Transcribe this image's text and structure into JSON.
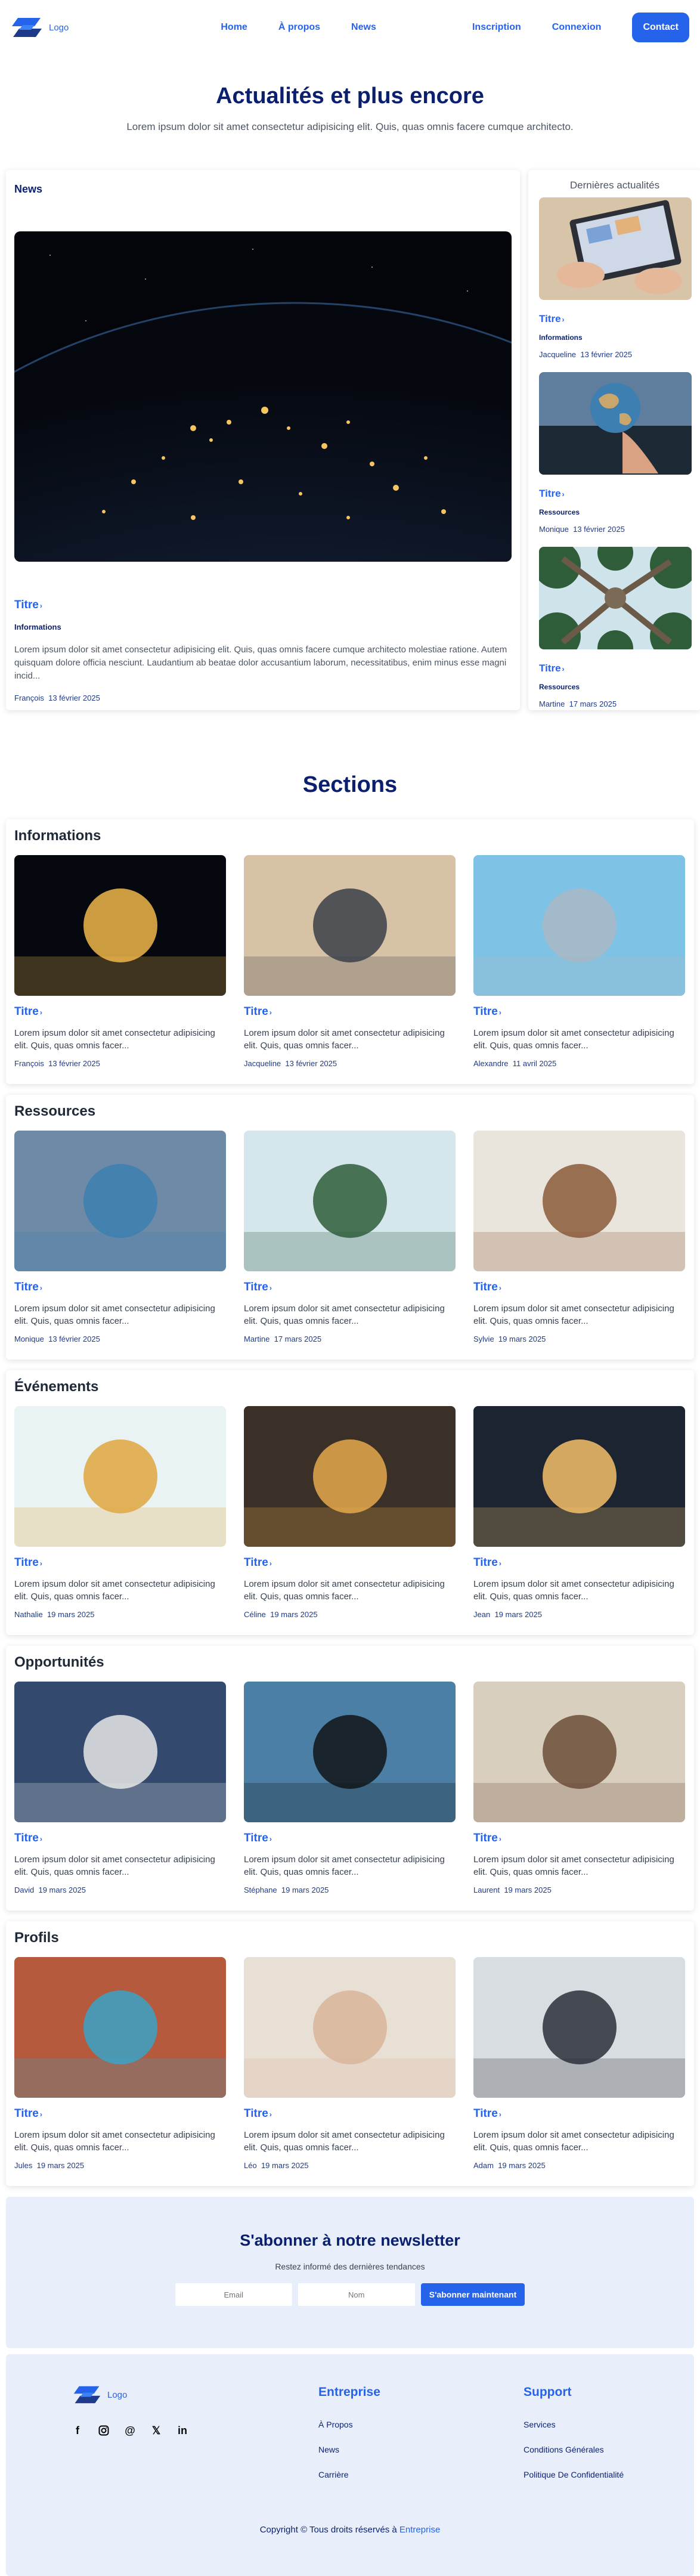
{
  "header": {
    "logo_text": "Logo",
    "nav": [
      "Home",
      "À propos",
      "News"
    ],
    "signup": "Inscription",
    "login": "Connexion",
    "contact": "Contact"
  },
  "hero": {
    "title": "Actualités et plus encore",
    "subtitle": "Lorem ipsum dolor sit amet consectetur adipisicing elit. Quis, quas omnis facere cumque architecto."
  },
  "news": {
    "label": "News",
    "title": "Titre",
    "category": "Informations",
    "description": "Lorem ipsum dolor sit amet consectetur adipisicing elit. Quis, quas omnis facere cumque architecto molestiae ratione. Autem quisquam dolore officia nesciunt. Laudantium ab beatae dolor accusantium laborum, necessitatibus, enim minus esse magni incid...",
    "author": "François",
    "date": "13 février 2025"
  },
  "latest": {
    "title": "Dernières actualités",
    "items": [
      {
        "title": "Titre",
        "category": "Informations",
        "author": "Jacqueline",
        "date": "13 février 2025"
      },
      {
        "title": "Titre",
        "category": "Ressources",
        "author": "Monique",
        "date": "13 février 2025"
      },
      {
        "title": "Titre",
        "category": "Ressources",
        "author": "Martine",
        "date": "17 mars 2025"
      }
    ]
  },
  "sections_title": "Sections",
  "card_desc": "Lorem ipsum dolor sit amet consectetur adipisicing elit. Quis, quas omnis facer...",
  "sections": [
    {
      "name": "Informations",
      "cards": [
        {
          "title": "Titre",
          "author": "François",
          "date": "13 février 2025"
        },
        {
          "title": "Titre",
          "author": "Jacqueline",
          "date": "13 février 2025"
        },
        {
          "title": "Titre",
          "author": "Alexandre",
          "date": "11 avril 2025"
        }
      ]
    },
    {
      "name": "Ressources",
      "cards": [
        {
          "title": "Titre",
          "author": "Monique",
          "date": "13 février 2025"
        },
        {
          "title": "Titre",
          "author": "Martine",
          "date": "17 mars 2025"
        },
        {
          "title": "Titre",
          "author": "Sylvie",
          "date": "19 mars 2025"
        }
      ]
    },
    {
      "name": "Événements",
      "cards": [
        {
          "title": "Titre",
          "author": "Nathalie",
          "date": "19 mars 2025"
        },
        {
          "title": "Titre",
          "author": "Céline",
          "date": "19 mars 2025"
        },
        {
          "title": "Titre",
          "author": "Jean",
          "date": "19 mars 2025"
        }
      ]
    },
    {
      "name": "Opportunités",
      "cards": [
        {
          "title": "Titre",
          "author": "David",
          "date": "19 mars 2025"
        },
        {
          "title": "Titre",
          "author": "Stéphane",
          "date": "19 mars 2025"
        },
        {
          "title": "Titre",
          "author": "Laurent",
          "date": "19 mars 2025"
        }
      ]
    },
    {
      "name": "Profils",
      "cards": [
        {
          "title": "Titre",
          "author": "Jules",
          "date": "19 mars 2025"
        },
        {
          "title": "Titre",
          "author": "Léo",
          "date": "19 mars 2025"
        },
        {
          "title": "Titre",
          "author": "Adam",
          "date": "19 mars 2025"
        }
      ]
    }
  ],
  "newsletter": {
    "title": "S'abonner à notre newsletter",
    "subtitle": "Restez informé des dernières tendances",
    "email_placeholder": "Email",
    "name_placeholder": "Nom",
    "button": "S'abonner maintenant"
  },
  "footer": {
    "logo_text": "Logo",
    "col1_title": "Entreprise",
    "col1_links": [
      "À Propos",
      "News",
      "Carrière"
    ],
    "col2_title": "Support",
    "col2_links": [
      "Services",
      "Conditions Générales",
      "Politique De Confidentialité"
    ],
    "copyright": "Copyright © Tous droits réservés à",
    "copyright_link": "Entreprise"
  },
  "colors": {
    "accent": "#2563eb",
    "navy": "#0a1f6e",
    "panel": "#e8effb"
  }
}
